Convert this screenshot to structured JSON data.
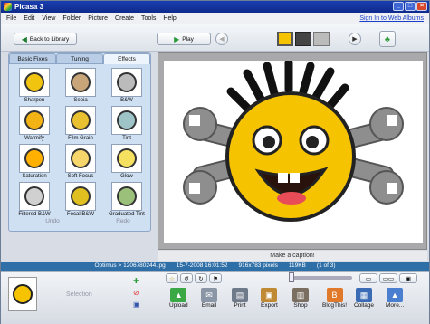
{
  "window": {
    "title": "Picasa 3",
    "min": "_",
    "max": "□",
    "close": "×"
  },
  "menu": {
    "items": [
      "File",
      "Edit",
      "View",
      "Folder",
      "Picture",
      "Create",
      "Tools",
      "Help"
    ],
    "signin": "Sign In to Web Albums"
  },
  "toolbar": {
    "back_label": "Back to Library",
    "play_label": "Play"
  },
  "tabs": [
    "Basic Fixes",
    "Tuning",
    "Effects"
  ],
  "effects": [
    {
      "label": "Sharpen",
      "tone": "#f1c40f"
    },
    {
      "label": "Sepia",
      "tone": "#c9a57a"
    },
    {
      "label": "B&W",
      "tone": "#bbbbbb"
    },
    {
      "label": "Warmify",
      "tone": "#f3b315"
    },
    {
      "label": "Film Grain",
      "tone": "#e8c030"
    },
    {
      "label": "Tint",
      "tone": "#9fc4c8"
    },
    {
      "label": "Saturation",
      "tone": "#ffb000"
    },
    {
      "label": "Soft Focus",
      "tone": "#f6d56a"
    },
    {
      "label": "Glow",
      "tone": "#f6e060"
    },
    {
      "label": "Filtered B&W",
      "tone": "#d0d0d0"
    },
    {
      "label": "Focal B&W",
      "tone": "#e0c020"
    },
    {
      "label": "Graduated Tint",
      "tone": "#9bc07a"
    }
  ],
  "panel": {
    "undo": "Undo",
    "redo": "Redo"
  },
  "caption": "Make a caption!",
  "status": {
    "path": "Optimus > 1206780244.jpg",
    "date": "15-7-2008 16:01:52",
    "dims": "916x783 pixels",
    "size": "119KB",
    "index": "(1 of 3)"
  },
  "tray": {
    "selection": "Selection",
    "actions": [
      {
        "label": "Upload",
        "color": "#3aa845",
        "glyph": "▲"
      },
      {
        "label": "Email",
        "color": "#8a96a6",
        "glyph": "✉"
      },
      {
        "label": "Print",
        "color": "#6f7b8a",
        "glyph": "▤"
      },
      {
        "label": "Export",
        "color": "#c08a35",
        "glyph": "▣"
      },
      {
        "label": "Shop",
        "color": "#7a6f60",
        "glyph": "▥"
      },
      {
        "label": "BlogThis!",
        "color": "#e07a2a",
        "glyph": "B"
      },
      {
        "label": "Collage",
        "color": "#3b6bb4",
        "glyph": "▦"
      },
      {
        "label": "More...",
        "color": "#4a7fd0",
        "glyph": "▲"
      }
    ]
  },
  "colors": {
    "face": "#f6c300",
    "titlebar": "#1a3fb0",
    "status": "#2f6fa8"
  }
}
